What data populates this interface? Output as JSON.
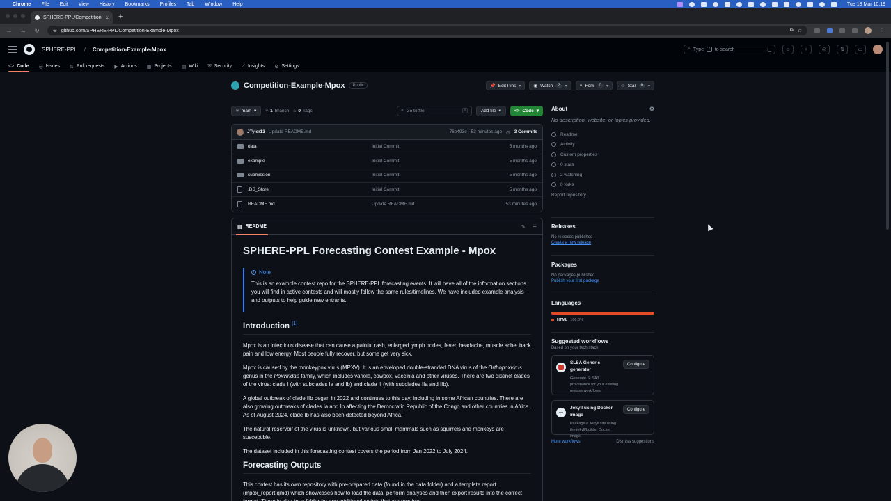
{
  "menubar": {
    "app": "Chrome",
    "items": [
      "File",
      "Edit",
      "View",
      "History",
      "Bookmarks",
      "Profiles",
      "Tab",
      "Window",
      "Help"
    ],
    "clock": "Tue 18 Mar  10:19"
  },
  "browser": {
    "tab_title": "SPHERE-PPL/Competition-E",
    "url": "github.com/SPHERE-PPL/Competition-Example-Mpox"
  },
  "github": {
    "owner": "SPHERE-PPL",
    "repo": "Competition-Example-Mpox",
    "search_placeholder": "Type / to search",
    "search_prefix": "Type",
    "search_key": "/",
    "search_suffix": "to search",
    "nav": [
      {
        "label": "Code",
        "icon": "<>"
      },
      {
        "label": "Issues",
        "icon": "◎"
      },
      {
        "label": "Pull requests",
        "icon": "⇅"
      },
      {
        "label": "Actions",
        "icon": "▶"
      },
      {
        "label": "Projects",
        "icon": "▦"
      },
      {
        "label": "Wiki",
        "icon": "▤"
      },
      {
        "label": "Security",
        "icon": "⛨"
      },
      {
        "label": "Insights",
        "icon": "⟋"
      },
      {
        "label": "Settings",
        "icon": "⚙"
      }
    ]
  },
  "repo": {
    "title": "Competition-Example-Mpox",
    "visibility": "Public",
    "edit_pins": "Edit Pins",
    "watch": "Watch",
    "watch_count": "2",
    "fork": "Fork",
    "fork_count": "0",
    "star": "Star",
    "star_count": "0"
  },
  "branch": {
    "name": "main",
    "branch_count": "1",
    "branch_label": "Branch",
    "tag_count": "0",
    "tag_label": "Tags",
    "goto_placeholder": "Go to file",
    "goto_key": "t",
    "add_file": "Add file",
    "code": "Code"
  },
  "latest_commit": {
    "author": "JTyler13",
    "message": "Update README.md",
    "hash_time": "76e493e · 53 minutes ago",
    "commits": "3 Commits"
  },
  "files": [
    {
      "name": "data",
      "type": "folder",
      "commit": "Initial Commit",
      "date": "5 months ago"
    },
    {
      "name": "example",
      "type": "folder",
      "commit": "Initial Commit",
      "date": "5 months ago"
    },
    {
      "name": "submission",
      "type": "folder",
      "commit": "Initial Commit",
      "date": "5 months ago"
    },
    {
      "name": ".DS_Store",
      "type": "file",
      "commit": "Initial Commit",
      "date": "5 months ago"
    },
    {
      "name": "README.md",
      "type": "file",
      "commit": "Update README.md",
      "date": "53 minutes ago"
    }
  ],
  "readme": {
    "tab": "README",
    "title": "SPHERE-PPL Forecasting Contest Example - Mpox",
    "note_label": "Note",
    "note_text": "This is an example contest repo for the SPHERE-PPL forecasting events. It will have all of the information sections you will find in active contests and will mostly follow the same rules/timelines. We have included example analysis and outputs to help guide new entrants.",
    "intro_heading": "Introduction",
    "intro_ref": "[1]",
    "p1": "Mpox is an infectious disease that can cause a painful rash, enlarged lymph nodes, fever, headache, muscle ache, back pain and low energy. Most people fully recover, but some get very sick.",
    "p2_a": "Mpox is caused by the monkeypox virus (MPXV). It is an enveloped double-stranded DNA virus of the ",
    "p2_genus": "Orthopoxvirus",
    "p2_b": " genus in the ",
    "p2_family": "Poxviridae",
    "p2_c": " family, which includes variola, cowpox, vaccinia and other viruses. There are two distinct clades of the virus: clade I (with subclades Ia and Ib) and clade II (with subclades IIa and IIb).",
    "p3": "A global outbreak of clade IIb began in 2022 and continues to this day, including in some African countries. There are also growing outbreaks of clades Ia and Ib affecting the Democratic Republic of the Congo and other countries in Africa. As of August 2024, clade Ib has also been detected beyond Africa.",
    "p4": "The natural reservoir of the virus is unknown, but various small mammals such as squirrels and monkeys are susceptible.",
    "p5": "The dataset included in this forecasting contest covers the period from Jan 2022 to July 2024.",
    "outputs_heading": "Forecasting Outputs",
    "p6": "This contest has its own repository with pre-prepared data (found in the data folder) and a template report (mpox_report.qmd) which showcases how to load the data, perform analyses and then export results into the correct format. There is also be a folder for any additional scripts that are required."
  },
  "about": {
    "heading": "About",
    "description": "No description, website, or topics provided.",
    "links": [
      "Readme",
      "Activity",
      "Custom properties",
      "0 stars",
      "2 watching",
      "0 forks"
    ],
    "report": "Report repository"
  },
  "releases": {
    "heading": "Releases",
    "none": "No releases published",
    "create": "Create a new release"
  },
  "packages": {
    "heading": "Packages",
    "none": "No packages published",
    "publish": "Publish your first package"
  },
  "languages": {
    "heading": "Languages",
    "name": "HTML",
    "percent": "100.0%",
    "fraction": 1.0,
    "color": "#e34c26"
  },
  "workflows": {
    "heading": "Suggested workflows",
    "sub": "Based on your tech stack",
    "items": [
      {
        "title": "SLSA Generic generator",
        "desc": "Generate SLSA3 provenance for your existing release workflows",
        "button": "Configure"
      },
      {
        "title": "Jekyll using Docker image",
        "desc": "Package a Jekyll site using the jekyll/builder Docker image.",
        "button": "Configure"
      }
    ],
    "more": "More workflows",
    "dismiss": "Dismiss suggestions"
  }
}
